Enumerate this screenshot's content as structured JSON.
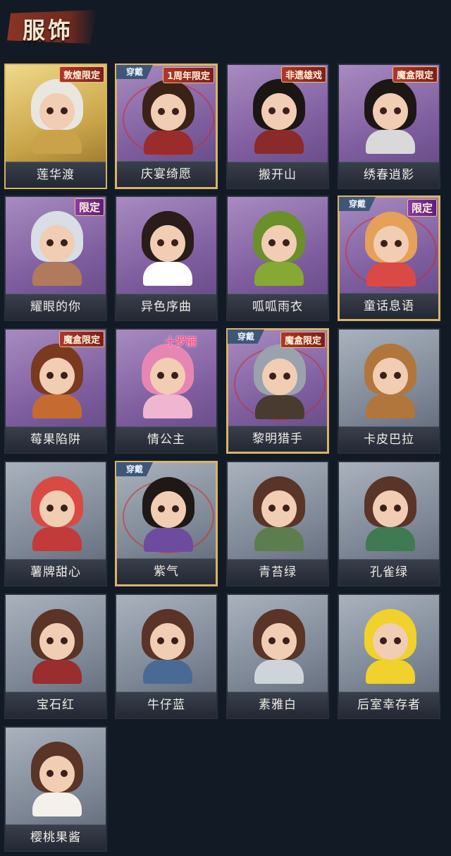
{
  "page": {
    "title": "服饰"
  },
  "labels": {
    "equipped": "穿戴"
  },
  "cards": [
    {
      "name": "莲华渡",
      "tag": "敦煌限定",
      "theme": "gold",
      "equipped": false,
      "hair": "#e9e6df",
      "outfit": "#c9a24a"
    },
    {
      "name": "庆宴绮愿",
      "tag": "1周年限定",
      "theme": "purple",
      "equipped": true,
      "hair": "#3a2217",
      "outfit": "#9b2c2c"
    },
    {
      "name": "搬开山",
      "tag": "非遗雄戏",
      "theme": "purple",
      "equipped": false,
      "hair": "#1b1614",
      "outfit": "#8a2a2a"
    },
    {
      "name": "绣春逍影",
      "tag": "魔盒限定",
      "theme": "purple",
      "equipped": false,
      "hair": "#1c1714",
      "outfit": "#d9d9d9"
    },
    {
      "name": "耀眼的你",
      "tag": "限定",
      "theme": "purple",
      "equipped": false,
      "hair": "#d8dde6",
      "outfit": "#b07a5c"
    },
    {
      "name": "异色序曲",
      "tag": "",
      "theme": "purple",
      "equipped": false,
      "hair": "#2a1d19",
      "outfit": "#ffffff"
    },
    {
      "name": "呱呱雨衣",
      "tag": "",
      "theme": "purple",
      "equipped": false,
      "hair": "#6b8f2a",
      "outfit": "#87a832"
    },
    {
      "name": "童话息语",
      "tag": "限定",
      "theme": "purple",
      "equipped": true,
      "hair": "#e5a05a",
      "outfit": "#d94a45"
    },
    {
      "name": "莓果陷阱",
      "tag": "魔盒限定",
      "theme": "purple",
      "equipped": false,
      "hair": "#7a3a20",
      "outfit": "#c56b32"
    },
    {
      "name": "情公主",
      "tag": "十罗丽",
      "theme": "purple",
      "equipped": false,
      "hair": "#e687b3",
      "outfit": "#f0b6cf"
    },
    {
      "name": "黎明猎手",
      "tag": "魔盒限定",
      "theme": "purple",
      "equipped": true,
      "hair": "#9aa2ad",
      "outfit": "#4a3b30"
    },
    {
      "name": "卡皮巴拉",
      "tag": "",
      "theme": "grey",
      "equipped": false,
      "hair": "#b0763b",
      "outfit": "#b0763b"
    },
    {
      "name": "薯牌甜心",
      "tag": "",
      "theme": "grey",
      "equipped": false,
      "hair": "#d94a45",
      "outfit": "#c23a3a"
    },
    {
      "name": "紫气",
      "tag": "",
      "theme": "grey",
      "equipped": true,
      "hair": "#1f1815",
      "outfit": "#6d4ca0"
    },
    {
      "name": "青苔绿",
      "tag": "",
      "theme": "grey",
      "equipped": false,
      "hair": "#5a3426",
      "outfit": "#5c7d4e"
    },
    {
      "name": "孔雀绿",
      "tag": "",
      "theme": "grey",
      "equipped": false,
      "hair": "#5a3426",
      "outfit": "#3f7a52"
    },
    {
      "name": "宝石红",
      "tag": "",
      "theme": "grey",
      "equipped": false,
      "hair": "#5a3426",
      "outfit": "#9a2d2d"
    },
    {
      "name": "牛仔蓝",
      "tag": "",
      "theme": "grey",
      "equipped": false,
      "hair": "#5a3426",
      "outfit": "#4a6a96"
    },
    {
      "name": "素雅白",
      "tag": "",
      "theme": "grey",
      "equipped": false,
      "hair": "#5a3426",
      "outfit": "#cfd4da"
    },
    {
      "name": "后室幸存者",
      "tag": "",
      "theme": "grey",
      "equipped": false,
      "hair": "#f1d12c",
      "outfit": "#f1d12c"
    },
    {
      "name": "樱桃果酱",
      "tag": "",
      "theme": "grey",
      "equipped": false,
      "hair": "#5a3426",
      "outfit": "#f4f1ea"
    }
  ]
}
